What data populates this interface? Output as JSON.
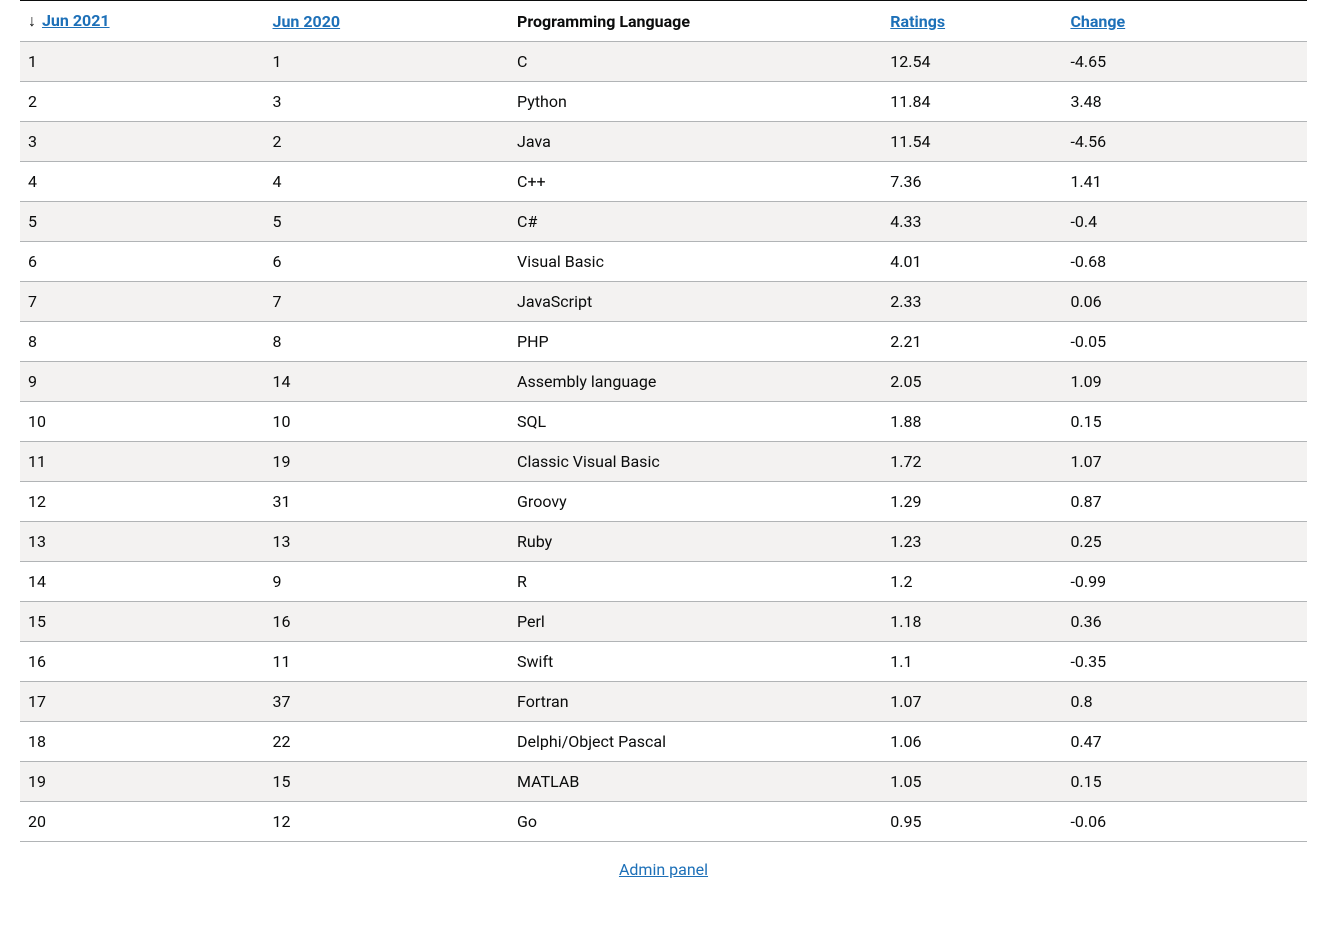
{
  "table": {
    "headers": {
      "jun2021": "Jun 2021",
      "jun2020": "Jun 2020",
      "language": "Programming Language",
      "ratings": "Ratings",
      "change": "Change"
    },
    "sort_indicator": "↓",
    "rows": [
      {
        "jun2021": "1",
        "jun2020": "1",
        "language": "C",
        "ratings": "12.54",
        "change": "-4.65"
      },
      {
        "jun2021": "2",
        "jun2020": "3",
        "language": "Python",
        "ratings": "11.84",
        "change": "3.48"
      },
      {
        "jun2021": "3",
        "jun2020": "2",
        "language": "Java",
        "ratings": "11.54",
        "change": "-4.56"
      },
      {
        "jun2021": "4",
        "jun2020": "4",
        "language": "C++",
        "ratings": "7.36",
        "change": "1.41"
      },
      {
        "jun2021": "5",
        "jun2020": "5",
        "language": "C#",
        "ratings": "4.33",
        "change": "-0.4"
      },
      {
        "jun2021": "6",
        "jun2020": "6",
        "language": "Visual Basic",
        "ratings": "4.01",
        "change": "-0.68"
      },
      {
        "jun2021": "7",
        "jun2020": "7",
        "language": "JavaScript",
        "ratings": "2.33",
        "change": "0.06"
      },
      {
        "jun2021": "8",
        "jun2020": "8",
        "language": "PHP",
        "ratings": "2.21",
        "change": "-0.05"
      },
      {
        "jun2021": "9",
        "jun2020": "14",
        "language": "Assembly language",
        "ratings": "2.05",
        "change": "1.09"
      },
      {
        "jun2021": "10",
        "jun2020": "10",
        "language": "SQL",
        "ratings": "1.88",
        "change": "0.15"
      },
      {
        "jun2021": "11",
        "jun2020": "19",
        "language": "Classic Visual Basic",
        "ratings": "1.72",
        "change": "1.07"
      },
      {
        "jun2021": "12",
        "jun2020": "31",
        "language": "Groovy",
        "ratings": "1.29",
        "change": "0.87"
      },
      {
        "jun2021": "13",
        "jun2020": "13",
        "language": "Ruby",
        "ratings": "1.23",
        "change": "0.25"
      },
      {
        "jun2021": "14",
        "jun2020": "9",
        "language": "R",
        "ratings": "1.2",
        "change": "-0.99"
      },
      {
        "jun2021": "15",
        "jun2020": "16",
        "language": "Perl",
        "ratings": "1.18",
        "change": "0.36"
      },
      {
        "jun2021": "16",
        "jun2020": "11",
        "language": "Swift",
        "ratings": "1.1",
        "change": "-0.35"
      },
      {
        "jun2021": "17",
        "jun2020": "37",
        "language": "Fortran",
        "ratings": "1.07",
        "change": "0.8"
      },
      {
        "jun2021": "18",
        "jun2020": "22",
        "language": "Delphi/Object Pascal",
        "ratings": "1.06",
        "change": "0.47"
      },
      {
        "jun2021": "19",
        "jun2020": "15",
        "language": "MATLAB",
        "ratings": "1.05",
        "change": "0.15"
      },
      {
        "jun2021": "20",
        "jun2020": "12",
        "language": "Go",
        "ratings": "0.95",
        "change": "-0.06"
      }
    ]
  },
  "footer": {
    "admin_link": "Admin panel"
  }
}
